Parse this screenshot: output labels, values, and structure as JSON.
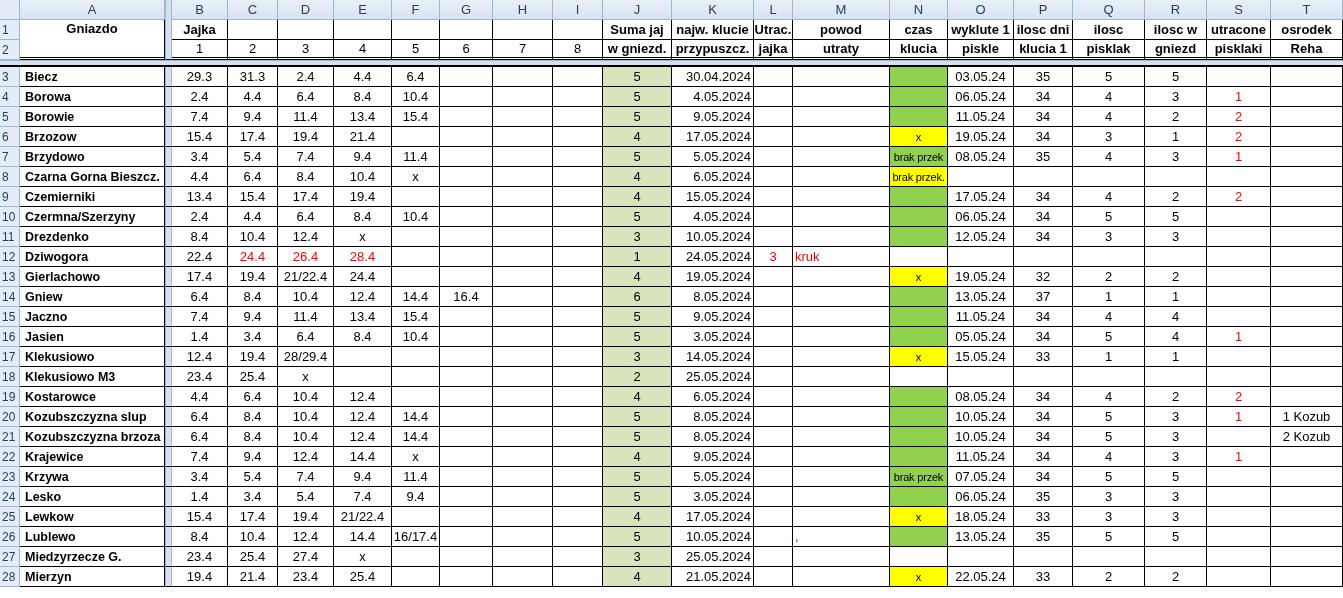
{
  "column_letters": [
    "A",
    "B",
    "C",
    "D",
    "E",
    "F",
    "G",
    "H",
    "I",
    "J",
    "K",
    "L",
    "M",
    "N",
    "O",
    "P",
    "Q",
    "R",
    "S",
    "T"
  ],
  "header_row_numbers": [
    "1",
    "2"
  ],
  "header": {
    "nest": "Gniazdo",
    "eggs_title": "Jajka",
    "egg_numbers": [
      "1",
      "2",
      "3",
      "4",
      "5",
      "6",
      "7",
      "8"
    ],
    "columns": [
      {
        "top": "Suma jaj",
        "bottom": "w gniezd."
      },
      {
        "top": "najw. klucie",
        "bottom": "przypuszcz."
      },
      {
        "top": "Utrac.",
        "bottom": "jajka"
      },
      {
        "top": "powod",
        "bottom": "utraty"
      },
      {
        "top": "czas",
        "bottom": "klucia"
      },
      {
        "top": "wyklute 1",
        "bottom": "piskle"
      },
      {
        "top": "ilosc dni",
        "bottom": "klucia 1"
      },
      {
        "top": "ilosc",
        "bottom": "pisklak"
      },
      {
        "top": "ilosc w",
        "bottom": "gniezd"
      },
      {
        "top": "utracone",
        "bottom": "pisklaki"
      },
      {
        "top": "osrodek",
        "bottom": "Reha"
      }
    ]
  },
  "rows": [
    {
      "number": "3",
      "nest": "Biecz",
      "eggs": [
        {
          "text": "29.3",
          "lost": false
        },
        {
          "text": "31.3",
          "lost": false
        },
        {
          "text": "2.4",
          "lost": false
        },
        {
          "text": "4.4",
          "lost": false
        },
        {
          "text": "6.4",
          "lost": false
        }
      ],
      "egg_sum": "5",
      "hatch_expected": "30.04.2024",
      "hatch_time": {
        "color": "#92d050"
      },
      "first_hatched": "03.05.24",
      "days": "35",
      "chicks": "5",
      "chicks_in_nest": "5"
    },
    {
      "number": "4",
      "nest": "Borowa",
      "eggs": [
        {
          "text": "2.4",
          "lost": false
        },
        {
          "text": "4.4",
          "lost": false
        },
        {
          "text": "6.4",
          "lost": false
        },
        {
          "text": "8.4",
          "lost": false
        },
        {
          "text": "10.4",
          "lost": false
        }
      ],
      "egg_sum": "5",
      "hatch_expected": "4.05.2024",
      "hatch_time": {
        "color": "#92d050"
      },
      "first_hatched": "06.05.24",
      "days": "34",
      "chicks": "4",
      "chicks_in_nest": "3",
      "lost_chicks": "1"
    },
    {
      "number": "5",
      "nest": "Borowie",
      "eggs": [
        {
          "text": "7.4",
          "lost": false
        },
        {
          "text": "9.4",
          "lost": false
        },
        {
          "text": "11.4",
          "lost": false
        },
        {
          "text": "13.4",
          "lost": false
        },
        {
          "text": "15.4",
          "lost": false
        }
      ],
      "egg_sum": "5",
      "hatch_expected": "9.05.2024",
      "hatch_time": {
        "color": "#92d050"
      },
      "first_hatched": "11.05.24",
      "days": "34",
      "chicks": "4",
      "chicks_in_nest": "2",
      "lost_chicks": "2"
    },
    {
      "number": "6",
      "nest": "Brzozow",
      "eggs": [
        {
          "text": "15.4",
          "lost": false
        },
        {
          "text": "17.4",
          "lost": false
        },
        {
          "text": "19.4",
          "lost": false
        },
        {
          "text": "21.4",
          "lost": false
        }
      ],
      "egg_sum": "4",
      "hatch_expected": "17.05.2024",
      "hatch_time": {
        "color": "#ffff00",
        "text": "x"
      },
      "first_hatched": "19.05.24",
      "days": "34",
      "chicks": "3",
      "chicks_in_nest": "1",
      "lost_chicks": "2"
    },
    {
      "number": "7",
      "nest": "Brzydowo",
      "eggs": [
        {
          "text": "3.4",
          "lost": false
        },
        {
          "text": "5.4",
          "lost": false
        },
        {
          "text": "7.4",
          "lost": false
        },
        {
          "text": "9.4",
          "lost": false
        },
        {
          "text": "11.4",
          "lost": false
        }
      ],
      "egg_sum": "5",
      "hatch_expected": "5.05.2024",
      "hatch_time": {
        "color": "#92d050",
        "text": "brak przek"
      },
      "first_hatched": "08.05.24",
      "days": "35",
      "chicks": "4",
      "chicks_in_nest": "3",
      "lost_chicks": "1"
    },
    {
      "number": "8",
      "nest": "Czarna Gorna Bieszcz.",
      "eggs": [
        {
          "text": "4.4",
          "lost": false
        },
        {
          "text": "6.4",
          "lost": false
        },
        {
          "text": "8.4",
          "lost": false
        },
        {
          "text": "10.4",
          "lost": false
        },
        {
          "text": "x",
          "lost": false
        }
      ],
      "egg_sum": "4",
      "hatch_expected": "6.05.2024",
      "hatch_time": {
        "color": "#ffff00",
        "text": "brak przek."
      }
    },
    {
      "number": "9",
      "nest": "Czemierniki",
      "eggs": [
        {
          "text": "13.4",
          "lost": false
        },
        {
          "text": "15.4",
          "lost": false
        },
        {
          "text": "17.4",
          "lost": false
        },
        {
          "text": "19.4",
          "lost": false
        }
      ],
      "egg_sum": "4",
      "hatch_expected": "15.05.2024",
      "hatch_time": {
        "color": "#92d050"
      },
      "first_hatched": "17.05.24",
      "days": "34",
      "chicks": "4",
      "chicks_in_nest": "2",
      "lost_chicks": "2"
    },
    {
      "number": "10",
      "nest": "Czermna/Szerzyny",
      "eggs": [
        {
          "text": "2.4",
          "lost": false
        },
        {
          "text": "4.4",
          "lost": false
        },
        {
          "text": "6.4",
          "lost": false
        },
        {
          "text": "8.4",
          "lost": false
        },
        {
          "text": "10.4",
          "lost": false
        }
      ],
      "egg_sum": "5",
      "hatch_expected": "4.05.2024",
      "hatch_time": {
        "color": "#92d050"
      },
      "first_hatched": "06.05.24",
      "days": "34",
      "chicks": "5",
      "chicks_in_nest": "5"
    },
    {
      "number": "11",
      "nest": "Drezdenko",
      "eggs": [
        {
          "text": "8.4",
          "lost": false
        },
        {
          "text": "10.4",
          "lost": false
        },
        {
          "text": "12.4",
          "lost": false
        },
        {
          "text": "x",
          "lost": false
        }
      ],
      "egg_sum": "3",
      "hatch_expected": "10.05.2024",
      "hatch_time": {
        "color": "#92d050"
      },
      "first_hatched": "12.05.24",
      "days": "34",
      "chicks": "3",
      "chicks_in_nest": "3"
    },
    {
      "number": "12",
      "nest": "Dziwogora",
      "eggs": [
        {
          "text": "22.4",
          "lost": false
        },
        {
          "text": "24.4",
          "lost": true
        },
        {
          "text": "26.4",
          "lost": true
        },
        {
          "text": "28.4",
          "lost": true
        }
      ],
      "egg_sum": "1",
      "hatch_expected": "24.05.2024",
      "lost_eggs": "3",
      "loss_reason": "kruk"
    },
    {
      "number": "13",
      "nest": "Gierlachowo",
      "eggs": [
        {
          "text": "17.4",
          "lost": false
        },
        {
          "text": "19.4",
          "lost": false
        },
        {
          "text": "21/22.4",
          "lost": false
        },
        {
          "text": "24.4",
          "lost": false
        }
      ],
      "egg_sum": "4",
      "hatch_expected": "19.05.2024",
      "hatch_time": {
        "color": "#ffff00",
        "text": "x"
      },
      "first_hatched": "19.05.24",
      "days": "32",
      "chicks": "2",
      "chicks_in_nest": "2"
    },
    {
      "number": "14",
      "nest": "Gniew",
      "eggs": [
        {
          "text": "6.4",
          "lost": false
        },
        {
          "text": "8.4",
          "lost": false
        },
        {
          "text": "10.4",
          "lost": false
        },
        {
          "text": "12.4",
          "lost": false
        },
        {
          "text": "14.4",
          "lost": false
        },
        {
          "text": "16.4",
          "lost": false
        }
      ],
      "egg_sum": "6",
      "hatch_expected": "8.05.2024",
      "hatch_time": {
        "color": "#92d050"
      },
      "first_hatched": "13.05.24",
      "days": "37",
      "chicks": "1",
      "chicks_in_nest": "1"
    },
    {
      "number": "15",
      "nest": "Jaczno",
      "eggs": [
        {
          "text": "7.4",
          "lost": false
        },
        {
          "text": "9.4",
          "lost": false
        },
        {
          "text": "11.4",
          "lost": false
        },
        {
          "text": "13.4",
          "lost": false
        },
        {
          "text": "15.4",
          "lost": false
        }
      ],
      "egg_sum": "5",
      "hatch_expected": "9.05.2024",
      "hatch_time": {
        "color": "#92d050"
      },
      "first_hatched": "11.05.24",
      "days": "34",
      "chicks": "4",
      "chicks_in_nest": "4"
    },
    {
      "number": "16",
      "nest": "Jasien",
      "eggs": [
        {
          "text": "1.4",
          "lost": false
        },
        {
          "text": "3.4",
          "lost": false
        },
        {
          "text": "6.4",
          "lost": false
        },
        {
          "text": "8.4",
          "lost": false
        },
        {
          "text": "10.4",
          "lost": false
        }
      ],
      "egg_sum": "5",
      "hatch_expected": "3.05.2024",
      "hatch_time": {
        "color": "#92d050"
      },
      "first_hatched": "05.05.24",
      "days": "34",
      "chicks": "5",
      "chicks_in_nest": "4",
      "lost_chicks": "1"
    },
    {
      "number": "17",
      "nest": "Klekusiowo",
      "eggs": [
        {
          "text": "12.4",
          "lost": false
        },
        {
          "text": "19.4",
          "lost": false
        },
        {
          "text": "28/29.4",
          "lost": false
        }
      ],
      "egg_sum": "3",
      "hatch_expected": "14.05.2024",
      "hatch_time": {
        "color": "#ffff00",
        "text": "x"
      },
      "first_hatched": "15.05.24",
      "days": "33",
      "chicks": "1",
      "chicks_in_nest": "1"
    },
    {
      "number": "18",
      "nest": "Klekusiowo M3",
      "eggs": [
        {
          "text": "23.4",
          "lost": false
        },
        {
          "text": "25.4",
          "lost": false
        },
        {
          "text": "x",
          "lost": false
        }
      ],
      "egg_sum": "2",
      "hatch_expected": "25.05.2024"
    },
    {
      "number": "19",
      "nest": "Kostarowce",
      "eggs": [
        {
          "text": "4.4",
          "lost": false
        },
        {
          "text": "6.4",
          "lost": false
        },
        {
          "text": "10.4",
          "lost": false
        },
        {
          "text": "12.4",
          "lost": false
        }
      ],
      "egg_sum": "4",
      "hatch_expected": "6.05.2024",
      "hatch_time": {
        "color": "#92d050"
      },
      "first_hatched": "08.05.24",
      "days": "34",
      "chicks": "4",
      "chicks_in_nest": "2",
      "lost_chicks": "2"
    },
    {
      "number": "20",
      "nest": "Kozubszczyzna slup",
      "eggs": [
        {
          "text": "6.4",
          "lost": false
        },
        {
          "text": "8.4",
          "lost": false
        },
        {
          "text": "10.4",
          "lost": false
        },
        {
          "text": "12.4",
          "lost": false
        },
        {
          "text": "14.4",
          "lost": false
        }
      ],
      "egg_sum": "5",
      "hatch_expected": "8.05.2024",
      "hatch_time": {
        "color": "#92d050"
      },
      "first_hatched": "10.05.24",
      "days": "34",
      "chicks": "5",
      "chicks_in_nest": "3",
      "lost_chicks": "1",
      "rehab_center": "1 Kozub"
    },
    {
      "number": "21",
      "nest": "Kozubszczyzna brzoza",
      "eggs": [
        {
          "text": "6.4",
          "lost": false
        },
        {
          "text": "8.4",
          "lost": false
        },
        {
          "text": "10.4",
          "lost": false
        },
        {
          "text": "12.4",
          "lost": false
        },
        {
          "text": "14.4",
          "lost": false
        }
      ],
      "egg_sum": "5",
      "hatch_expected": "8.05.2024",
      "hatch_time": {
        "color": "#92d050"
      },
      "first_hatched": "10.05.24",
      "days": "34",
      "chicks": "5",
      "chicks_in_nest": "3",
      "rehab_center": "2 Kozub"
    },
    {
      "number": "22",
      "nest": "Krajewice",
      "eggs": [
        {
          "text": "7.4",
          "lost": false
        },
        {
          "text": "9.4",
          "lost": false
        },
        {
          "text": "12.4",
          "lost": false
        },
        {
          "text": "14.4",
          "lost": false
        },
        {
          "text": "x",
          "lost": false
        }
      ],
      "egg_sum": "4",
      "hatch_expected": "9.05.2024",
      "hatch_time": {
        "color": "#92d050"
      },
      "first_hatched": "11.05.24",
      "days": "34",
      "chicks": "4",
      "chicks_in_nest": "3",
      "lost_chicks": "1"
    },
    {
      "number": "23",
      "nest": "Krzywa",
      "eggs": [
        {
          "text": "3.4",
          "lost": false
        },
        {
          "text": "5.4",
          "lost": false
        },
        {
          "text": "7.4",
          "lost": false
        },
        {
          "text": "9.4",
          "lost": false
        },
        {
          "text": "11.4",
          "lost": false
        }
      ],
      "egg_sum": "5",
      "hatch_expected": "5.05.2024",
      "hatch_time": {
        "color": "#92d050",
        "text": "brak przek"
      },
      "first_hatched": "07.05.24",
      "days": "34",
      "chicks": "5",
      "chicks_in_nest": "5"
    },
    {
      "number": "24",
      "nest": "Lesko",
      "eggs": [
        {
          "text": "1.4",
          "lost": false
        },
        {
          "text": "3.4",
          "lost": false
        },
        {
          "text": "5.4",
          "lost": false
        },
        {
          "text": "7.4",
          "lost": false
        },
        {
          "text": "9.4",
          "lost": false
        }
      ],
      "egg_sum": "5",
      "hatch_expected": "3.05.2024",
      "hatch_time": {
        "color": "#92d050"
      },
      "first_hatched": "06.05.24",
      "days": "35",
      "chicks": "3",
      "chicks_in_nest": "3"
    },
    {
      "number": "25",
      "nest": "Lewkow",
      "eggs": [
        {
          "text": "15.4",
          "lost": false
        },
        {
          "text": "17.4",
          "lost": false
        },
        {
          "text": "19.4",
          "lost": false
        },
        {
          "text": "21/22.4",
          "lost": false
        }
      ],
      "egg_sum": "4",
      "hatch_expected": "17.05.2024",
      "hatch_time": {
        "color": "#ffff00",
        "text": "x"
      },
      "first_hatched": "18.05.24",
      "days": "33",
      "chicks": "3",
      "chicks_in_nest": "3"
    },
    {
      "number": "26",
      "nest": "Lublewo",
      "eggs": [
        {
          "text": "8.4",
          "lost": false
        },
        {
          "text": "10.4",
          "lost": false
        },
        {
          "text": "12.4",
          "lost": false
        },
        {
          "text": "14.4",
          "lost": false
        },
        {
          "text": "16/17.4",
          "lost": false
        }
      ],
      "egg_sum": "5",
      "hatch_expected": "10.05.2024",
      "loss_reason": ",",
      "hatch_time": {
        "color": "#92d050"
      },
      "first_hatched": "13.05.24",
      "days": "35",
      "chicks": "5",
      "chicks_in_nest": "5"
    },
    {
      "number": "27",
      "nest": "Miedzyrzecze G.",
      "eggs": [
        {
          "text": "23.4",
          "lost": false
        },
        {
          "text": "25.4",
          "lost": false
        },
        {
          "text": "27.4",
          "lost": false
        },
        {
          "text": "x",
          "lost": false
        }
      ],
      "egg_sum": "3",
      "hatch_expected": "25.05.2024"
    },
    {
      "number": "28",
      "nest": "Mierzyn",
      "eggs": [
        {
          "text": "19.4",
          "lost": false
        },
        {
          "text": "21.4",
          "lost": false
        },
        {
          "text": "23.4",
          "lost": false
        },
        {
          "text": "25.4",
          "lost": false
        }
      ],
      "egg_sum": "4",
      "hatch_expected": "21.05.2024",
      "hatch_time": {
        "color": "#ffff00",
        "text": "x"
      },
      "first_hatched": "22.05.24",
      "days": "33",
      "chicks": "2",
      "chicks_in_nest": "2"
    }
  ]
}
